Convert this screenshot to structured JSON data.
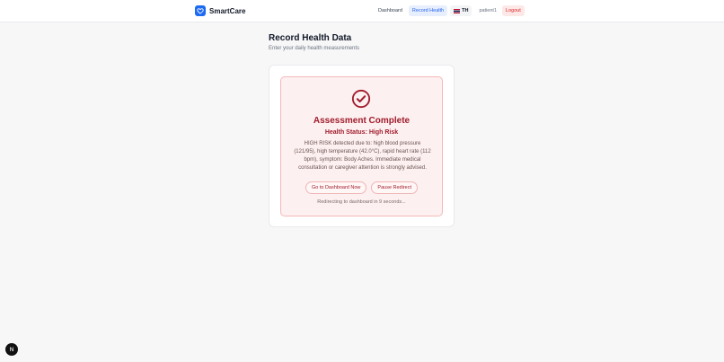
{
  "brand": {
    "name": "SmartCare"
  },
  "nav": {
    "dashboard": "Dashboard",
    "record_health": "Record Health",
    "language": "TH",
    "user": "patient1",
    "logout": "Logout"
  },
  "page": {
    "title": "Record Health Data",
    "subtitle": "Enter your daily health measurements"
  },
  "result": {
    "title": "Assessment Complete",
    "status": "Health Status: High Risk",
    "message": "HIGH RISK detected due to: high blood pressure (121/95), high temperature (42.0°C), rapid heart rate (112 bpm), symptom: Body Aches. Immediate medical consultation or caregiver attention is strongly advised.",
    "go_dashboard": "Go to Dashboard Now",
    "pause_redirect": "Pause Redirect",
    "redirect_note": "Redirecting to dashboard in 9 seconds..."
  },
  "dev_badge": {
    "letter": "N"
  },
  "icons": {
    "brand": "heart-icon",
    "flag": "thai-flag-icon",
    "result": "check-circle-icon"
  },
  "colors": {
    "brand": "#1d6af2",
    "risk": "#a01c2c",
    "alert_bg": "#fdf0f0",
    "logout": "#dc2626"
  }
}
